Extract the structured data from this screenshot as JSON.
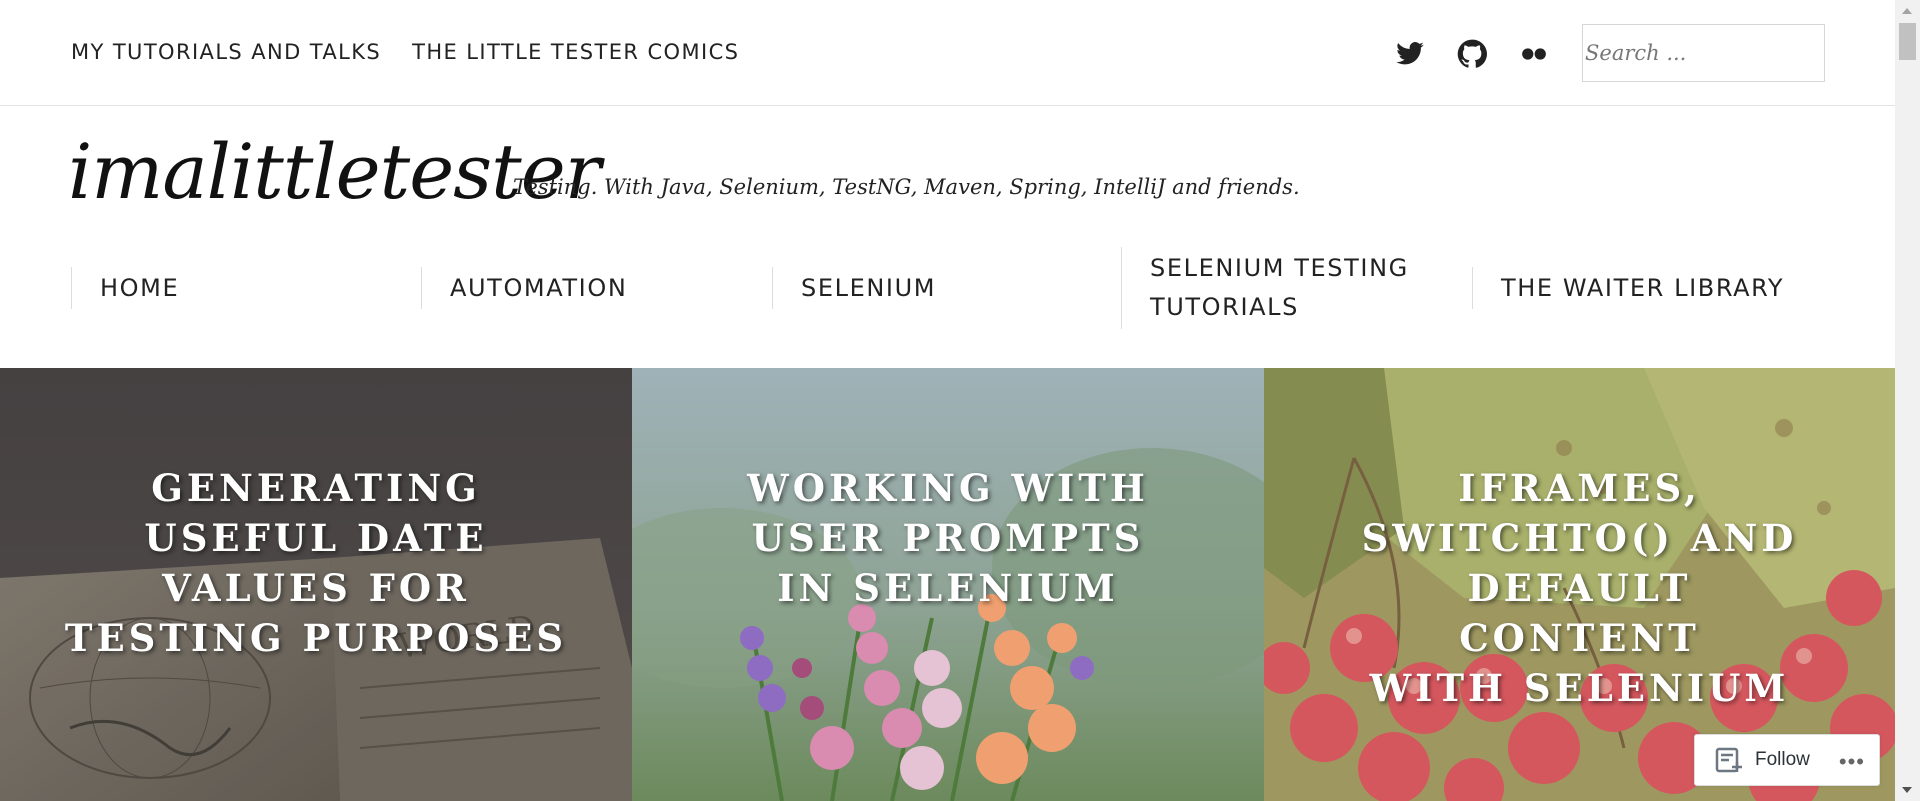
{
  "topnav": {
    "items": [
      "MY TUTORIALS AND TALKS",
      "THE LITTLE TESTER COMICS"
    ]
  },
  "social": {
    "icons": [
      "twitter-icon",
      "github-icon",
      "flickr-icon"
    ]
  },
  "search": {
    "placeholder": "Search ..."
  },
  "site": {
    "title": "imalittletester",
    "description": "Testing. With Java, Selenium, TestNG, Maven, Spring, IntelliJ and friends."
  },
  "mainnav": {
    "items": [
      {
        "label": "HOME"
      },
      {
        "label": "AUTOMATION"
      },
      {
        "label": "SELENIUM"
      },
      {
        "label_line1": "SELENIUM TESTING",
        "label_line2": "TUTORIALS"
      },
      {
        "label": "THE WAITER LIBRARY"
      }
    ]
  },
  "featured": [
    {
      "lines": [
        "GENERATING",
        "USEFUL DATE",
        "VALUES FOR",
        "TESTING PURPOSES"
      ]
    },
    {
      "lines": [
        "WORKING WITH",
        "USER PROMPTS",
        "IN SELENIUM"
      ]
    },
    {
      "lines": [
        "IFRAMES,",
        "SWITCHTO() AND",
        "DEFAULT",
        "CONTENT",
        "WITH SELENIUM"
      ]
    }
  ],
  "follow": {
    "label": "Follow",
    "more": "•••"
  },
  "colors": {
    "text": "#222222",
    "tile1": "#5a5350",
    "tile2": "#9aa9a8",
    "tile3": "#b5a277"
  }
}
